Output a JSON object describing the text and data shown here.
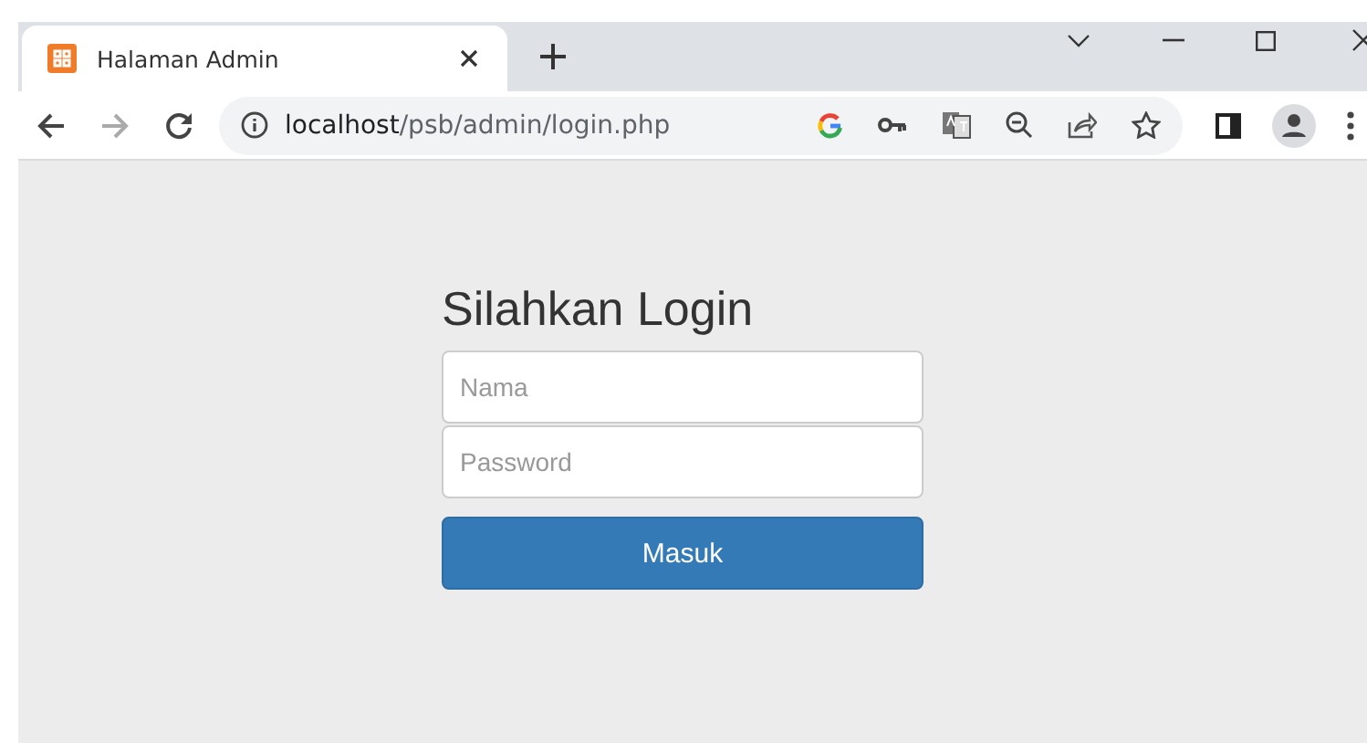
{
  "tabs": [
    {
      "title": "Halaman Admin",
      "selected": true
    }
  ],
  "address_bar": {
    "host": "localhost",
    "path": "/psb/admin/login.php"
  },
  "login_form": {
    "heading": "Silahkan Login",
    "fields": [
      {
        "placeholder": "Nama"
      },
      {
        "placeholder": "Password"
      }
    ],
    "submit": "Masuk"
  }
}
